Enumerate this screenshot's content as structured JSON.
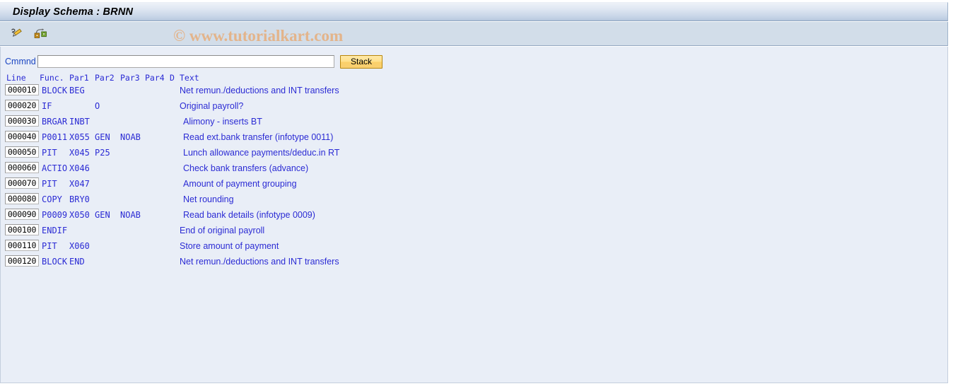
{
  "window": {
    "title": "Display Schema : BRNN"
  },
  "toolbar": {
    "icons": [
      {
        "name": "edit-pencil-icon",
        "label": "Display <-> Change"
      },
      {
        "name": "copy-transfer-icon",
        "label": "Other Schema"
      }
    ]
  },
  "watermark": {
    "text": "© www.tutorialkart.com"
  },
  "command": {
    "label": "Cmmnd",
    "value": "",
    "placeholder": "",
    "stack_label": "Stack"
  },
  "table": {
    "headers": {
      "line": "Line",
      "func": "Func.",
      "par1": "Par1",
      "par2": "Par2",
      "par3": "Par3",
      "par4": "Par4",
      "d": "D",
      "text": "Text"
    },
    "rows": [
      {
        "line": "000010",
        "func": "BLOCK",
        "par1": "BEG",
        "par2": "",
        "par3": "",
        "par4": "",
        "d": "",
        "text": "Net remun./deductions and INT transfers",
        "indent": false
      },
      {
        "line": "000020",
        "func": "IF",
        "par1": "",
        "par2": "O",
        "par3": "",
        "par4": "",
        "d": "",
        "text": "Original payroll?",
        "indent": false
      },
      {
        "line": "000030",
        "func": "BRGAR",
        "par1": "INBT",
        "par2": "",
        "par3": "",
        "par4": "",
        "d": "",
        "text": "Alimony - inserts BT",
        "indent": true
      },
      {
        "line": "000040",
        "func": "P0011",
        "par1": "X055",
        "par2": "GEN",
        "par3": "NOAB",
        "par4": "",
        "d": "",
        "text": "Read ext.bank transfer (infotype 0011)",
        "indent": true
      },
      {
        "line": "000050",
        "func": "PIT",
        "par1": "X045",
        "par2": "P25",
        "par3": "",
        "par4": "",
        "d": "",
        "text": "Lunch allowance payments/deduc.in RT",
        "indent": true
      },
      {
        "line": "000060",
        "func": "ACTIO",
        "par1": "X046",
        "par2": "",
        "par3": "",
        "par4": "",
        "d": "",
        "text": "Check bank transfers (advance)",
        "indent": true
      },
      {
        "line": "000070",
        "func": "PIT",
        "par1": "X047",
        "par2": "",
        "par3": "",
        "par4": "",
        "d": "",
        "text": "Amount of payment grouping",
        "indent": true
      },
      {
        "line": "000080",
        "func": "COPY",
        "par1": "BRY0",
        "par2": "",
        "par3": "",
        "par4": "",
        "d": "",
        "text": "Net rounding",
        "indent": true
      },
      {
        "line": "000090",
        "func": "P0009",
        "par1": "X050",
        "par2": "GEN",
        "par3": "NOAB",
        "par4": "",
        "d": "",
        "text": "Read bank details (infotype 0009)",
        "indent": true
      },
      {
        "line": "000100",
        "func": "ENDIF",
        "par1": "",
        "par2": "",
        "par3": "",
        "par4": "",
        "d": "",
        "text": "End of original payroll",
        "indent": false
      },
      {
        "line": "000110",
        "func": "PIT",
        "par1": "X060",
        "par2": "",
        "par3": "",
        "par4": "",
        "d": "",
        "text": "Store amount of payment",
        "indent": false
      },
      {
        "line": "000120",
        "func": "BLOCK",
        "par1": "END",
        "par2": "",
        "par3": "",
        "par4": "",
        "d": "",
        "text": "Net remun./deductions and INT transfers",
        "indent": false
      }
    ]
  },
  "colors": {
    "title_bar_top": "#eef2f8",
    "title_bar_bottom": "#b4c6dd",
    "toolbar_bg": "#d2dde9",
    "content_bg": "#e9eef7",
    "text_blue": "#2b2bd4",
    "label_blue": "#1b46c2",
    "stack_button": "#fbd069",
    "watermark": "#e5b184"
  }
}
